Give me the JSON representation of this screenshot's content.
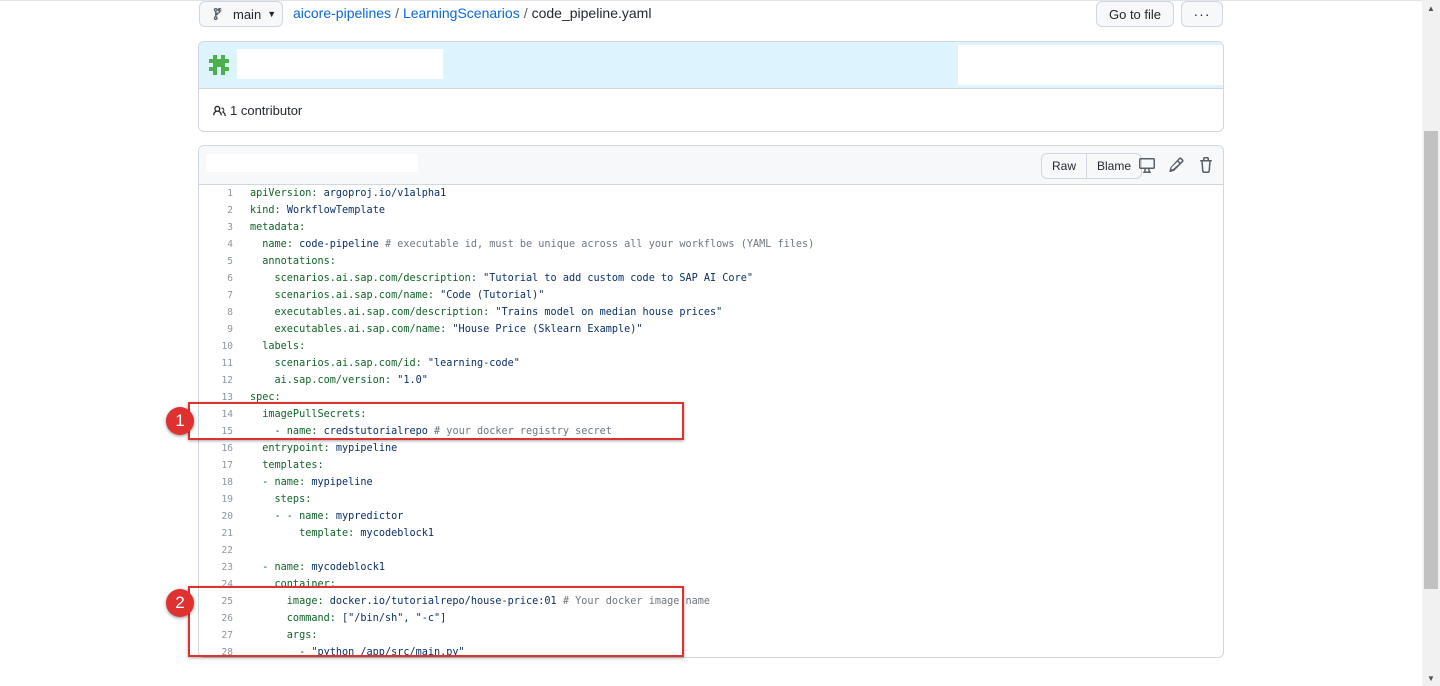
{
  "branch": {
    "name": "main"
  },
  "breadcrumb": {
    "repo": "aicore-pipelines",
    "folder": "LearningScenarios",
    "file": "code_pipeline.yaml",
    "separator": "/"
  },
  "actions": {
    "goto_label": "Go to file",
    "more_label": "···"
  },
  "commit": {
    "contributors": "1 contributor"
  },
  "file_toolbar": {
    "raw_label": "Raw",
    "blame_label": "Blame"
  },
  "code_lines": [
    {
      "n": "1",
      "k": "apiVersion",
      "s": ": ",
      "v": "argoproj.io/v1alpha1",
      "c": ""
    },
    {
      "n": "2",
      "k": "kind",
      "s": ": ",
      "v": "WorkflowTemplate",
      "c": ""
    },
    {
      "n": "3",
      "k": "metadata",
      "s": ":",
      "v": "",
      "c": ""
    },
    {
      "n": "4",
      "k": "  name",
      "s": ": ",
      "v": "code-pipeline",
      "c": " # executable id, must be unique across all your workflows (YAML files)"
    },
    {
      "n": "5",
      "k": "  annotations",
      "s": ":",
      "v": "",
      "c": ""
    },
    {
      "n": "6",
      "k": "    scenarios.ai.sap.com/description",
      "s": ": ",
      "v": "\"Tutorial to add custom code to SAP AI Core\"",
      "c": ""
    },
    {
      "n": "7",
      "k": "    scenarios.ai.sap.com/name",
      "s": ": ",
      "v": "\"Code (Tutorial)\"",
      "c": ""
    },
    {
      "n": "8",
      "k": "    executables.ai.sap.com/description",
      "s": ": ",
      "v": "\"Trains model on median house prices\"",
      "c": ""
    },
    {
      "n": "9",
      "k": "    executables.ai.sap.com/name",
      "s": ": ",
      "v": "\"House Price (Sklearn Example)\"",
      "c": ""
    },
    {
      "n": "10",
      "k": "  labels",
      "s": ":",
      "v": "",
      "c": ""
    },
    {
      "n": "11",
      "k": "    scenarios.ai.sap.com/id",
      "s": ": ",
      "v": "\"learning-code\"",
      "c": ""
    },
    {
      "n": "12",
      "k": "    ai.sap.com/version",
      "s": ": ",
      "v": "\"1.0\"",
      "c": ""
    },
    {
      "n": "13",
      "k": "spec",
      "s": ":",
      "v": "",
      "c": ""
    },
    {
      "n": "14",
      "k": "  imagePullSecrets",
      "s": ":",
      "v": "",
      "c": ""
    },
    {
      "n": "15",
      "k": "    - name",
      "s": ": ",
      "v": "credstutorialrepo",
      "c": " # your docker registry secret"
    },
    {
      "n": "16",
      "k": "  entrypoint",
      "s": ": ",
      "v": "mypipeline",
      "c": ""
    },
    {
      "n": "17",
      "k": "  templates",
      "s": ":",
      "v": "",
      "c": ""
    },
    {
      "n": "18",
      "k": "  - name",
      "s": ": ",
      "v": "mypipeline",
      "c": ""
    },
    {
      "n": "19",
      "k": "    steps",
      "s": ":",
      "v": "",
      "c": ""
    },
    {
      "n": "20",
      "k": "    - - name",
      "s": ": ",
      "v": "mypredictor",
      "c": ""
    },
    {
      "n": "21",
      "k": "        template",
      "s": ": ",
      "v": "mycodeblock1",
      "c": ""
    },
    {
      "n": "22",
      "k": "",
      "s": "",
      "v": "",
      "c": ""
    },
    {
      "n": "23",
      "k": "  - name",
      "s": ": ",
      "v": "mycodeblock1",
      "c": ""
    },
    {
      "n": "24",
      "k": "    container",
      "s": ":",
      "v": "",
      "c": ""
    },
    {
      "n": "25",
      "k": "      image",
      "s": ": ",
      "v": "docker.io/tutorialrepo/house-price:01",
      "c": " # Your docker image name"
    },
    {
      "n": "26",
      "k": "      command",
      "s": ": ",
      "v": "[\"/bin/sh\", \"-c\"]",
      "c": ""
    },
    {
      "n": "27",
      "k": "      args",
      "s": ":",
      "v": "",
      "c": ""
    },
    {
      "n": "28",
      "k": "        - ",
      "s": "",
      "v": "\"python /app/src/main.py\"",
      "c": ""
    }
  ],
  "annotations": [
    {
      "label": "1"
    },
    {
      "label": "2"
    }
  ],
  "colors": {
    "link": "#0969da",
    "annotation": "#e03131",
    "commit_bg": "#ddf4ff"
  }
}
